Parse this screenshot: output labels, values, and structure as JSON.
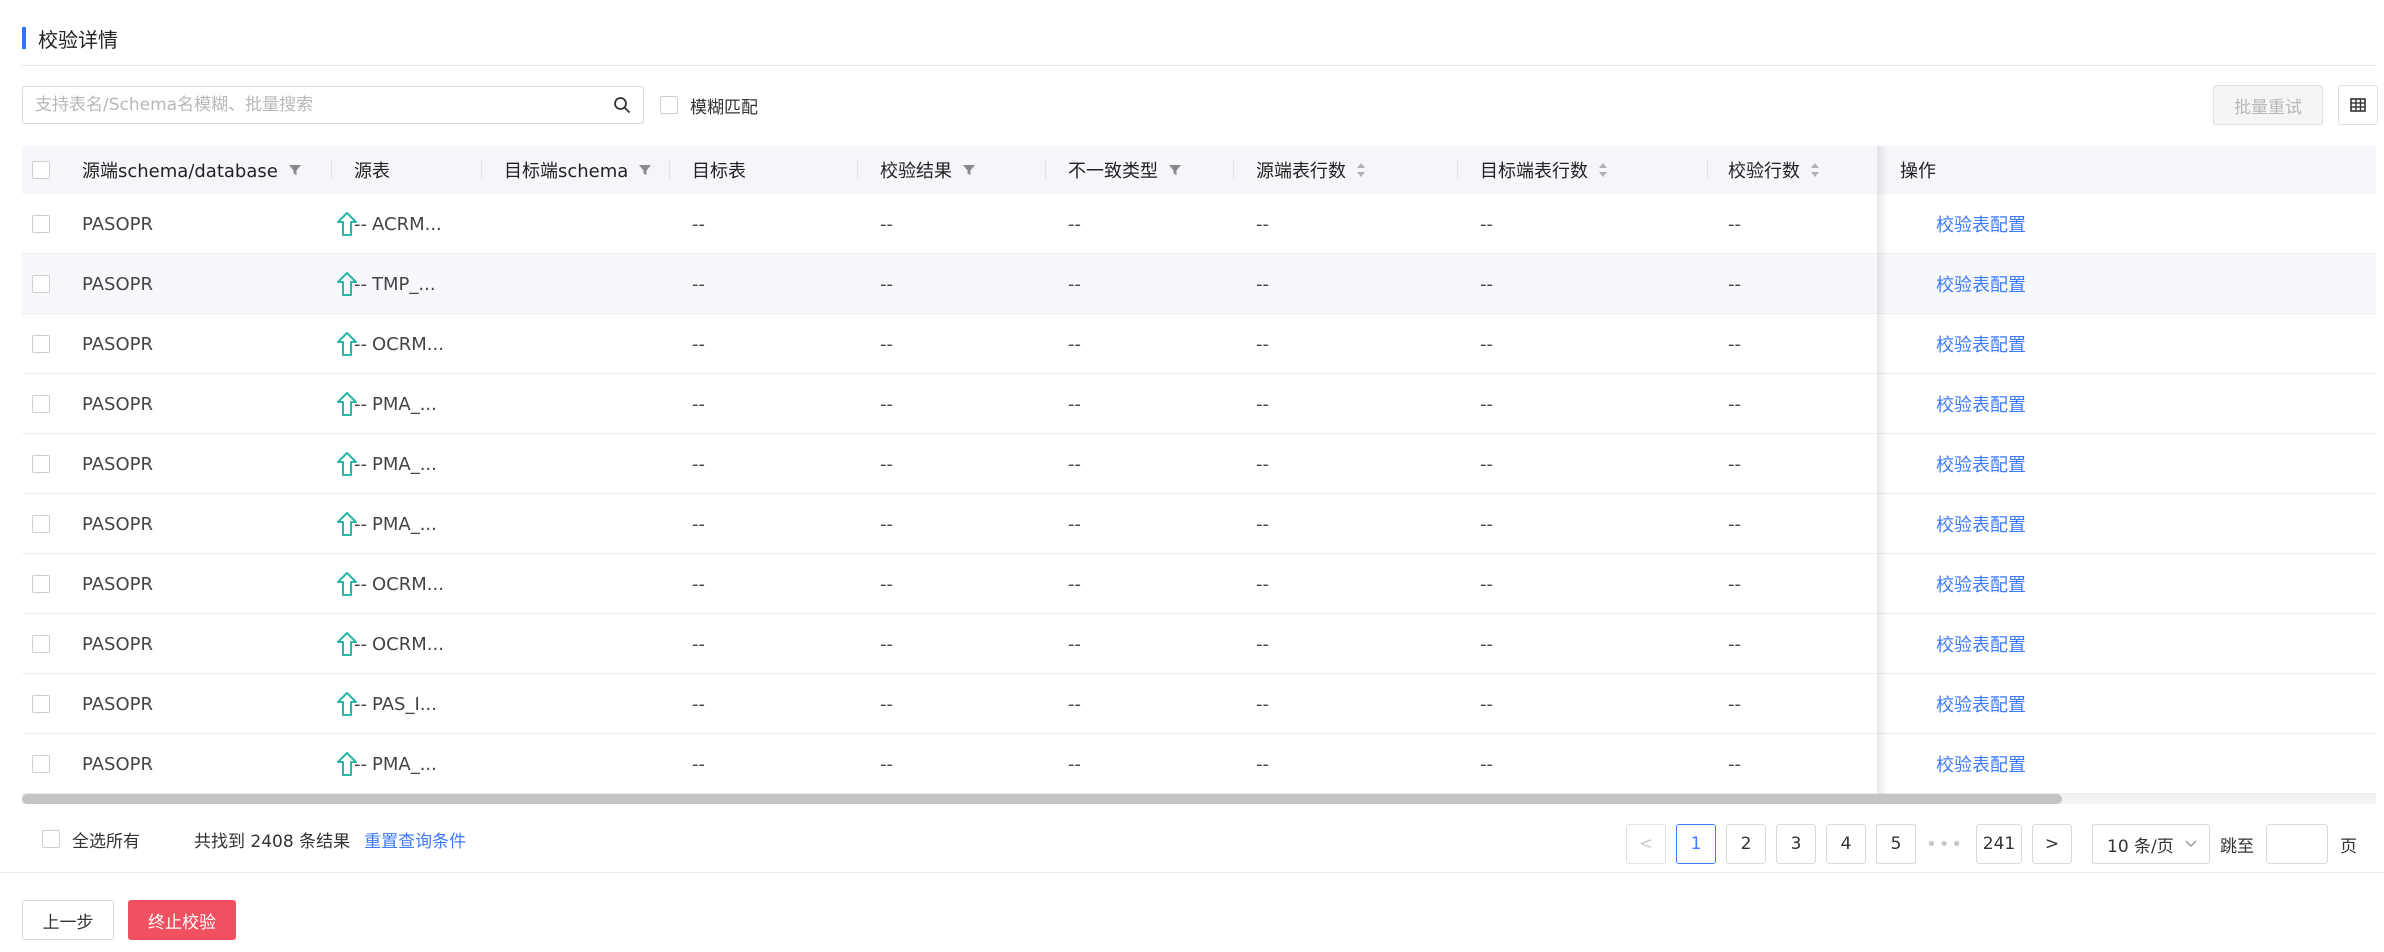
{
  "section": {
    "title": "校验详情"
  },
  "search": {
    "placeholder": "支持表名/Schema名模糊、批量搜索",
    "value": ""
  },
  "fuzzy_match": {
    "label": "模糊匹配",
    "checked": false
  },
  "toolbar": {
    "batch_retry_label": "批量重试"
  },
  "table": {
    "columns": {
      "source_schema": "源端schema/database",
      "source_table": "源表",
      "target_schema": "目标端schema",
      "target_table": "目标表",
      "check_result": "校验结果",
      "mismatch_type": "不一致类型",
      "source_rows": "源端表行数",
      "target_rows": "目标端表行数",
      "checked_rows": "校验行数",
      "operation": "操作"
    },
    "rows": [
      {
        "schema": "PASOPR",
        "table": "ACRM...",
        "target_schema": "--",
        "target_table": "--",
        "result": "--",
        "mismatch": "--",
        "src_rows": "--",
        "tgt_rows": "--",
        "chk_rows": "--",
        "action": "校验表配置"
      },
      {
        "schema": "PASOPR",
        "table": "TMP_...",
        "target_schema": "--",
        "target_table": "--",
        "result": "--",
        "mismatch": "--",
        "src_rows": "--",
        "tgt_rows": "--",
        "chk_rows": "--",
        "action": "校验表配置"
      },
      {
        "schema": "PASOPR",
        "table": "OCRM...",
        "target_schema": "--",
        "target_table": "--",
        "result": "--",
        "mismatch": "--",
        "src_rows": "--",
        "tgt_rows": "--",
        "chk_rows": "--",
        "action": "校验表配置"
      },
      {
        "schema": "PASOPR",
        "table": "PMA_...",
        "target_schema": "--",
        "target_table": "--",
        "result": "--",
        "mismatch": "--",
        "src_rows": "--",
        "tgt_rows": "--",
        "chk_rows": "--",
        "action": "校验表配置"
      },
      {
        "schema": "PASOPR",
        "table": "PMA_...",
        "target_schema": "--",
        "target_table": "--",
        "result": "--",
        "mismatch": "--",
        "src_rows": "--",
        "tgt_rows": "--",
        "chk_rows": "--",
        "action": "校验表配置"
      },
      {
        "schema": "PASOPR",
        "table": "PMA_...",
        "target_schema": "--",
        "target_table": "--",
        "result": "--",
        "mismatch": "--",
        "src_rows": "--",
        "tgt_rows": "--",
        "chk_rows": "--",
        "action": "校验表配置"
      },
      {
        "schema": "PASOPR",
        "table": "OCRM...",
        "target_schema": "--",
        "target_table": "--",
        "result": "--",
        "mismatch": "--",
        "src_rows": "--",
        "tgt_rows": "--",
        "chk_rows": "--",
        "action": "校验表配置"
      },
      {
        "schema": "PASOPR",
        "table": "OCRM...",
        "target_schema": "--",
        "target_table": "--",
        "result": "--",
        "mismatch": "--",
        "src_rows": "--",
        "tgt_rows": "--",
        "chk_rows": "--",
        "action": "校验表配置"
      },
      {
        "schema": "PASOPR",
        "table": "PAS_I...",
        "target_schema": "--",
        "target_table": "--",
        "result": "--",
        "mismatch": "--",
        "src_rows": "--",
        "tgt_rows": "--",
        "chk_rows": "--",
        "action": "校验表配置"
      },
      {
        "schema": "PASOPR",
        "table": "PMA_...",
        "target_schema": "--",
        "target_table": "--",
        "result": "--",
        "mismatch": "--",
        "src_rows": "--",
        "tgt_rows": "--",
        "chk_rows": "--",
        "action": "校验表配置"
      }
    ]
  },
  "footer": {
    "select_all_label": "全选所有",
    "result_count": "共找到 2408 条结果",
    "reset_label": "重置查询条件"
  },
  "pagination": {
    "prev": "<",
    "pages": [
      "1",
      "2",
      "3",
      "4",
      "5"
    ],
    "ellipsis": "•••",
    "last_page": "241",
    "next": ">",
    "current": "1",
    "page_size": "10 条/页",
    "jump_label": "跳至",
    "page_unit": "页"
  },
  "actions": {
    "prev_step": "上一步",
    "stop_check": "终止校验"
  },
  "colors": {
    "accent": "#3e7bfa",
    "danger": "#f0505f",
    "up_icon": "#2bb5a5"
  }
}
